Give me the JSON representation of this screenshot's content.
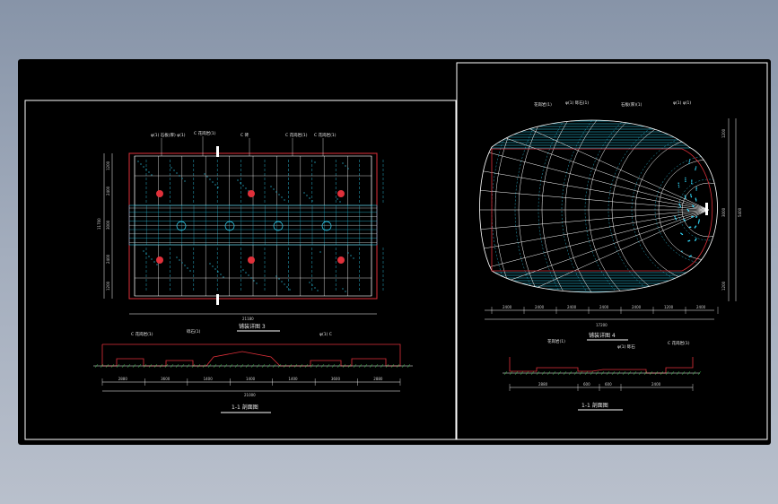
{
  "colors": {
    "background": "#000000",
    "frame": "#ffffff",
    "cyan": "#33ddff",
    "red": "#e0303a",
    "green": "#40ff60"
  },
  "left_sheet": {
    "plan_title": "铺装详图 3",
    "section_title": "1-1 剖面图",
    "callouts_top": [
      "φ(1) 石板(厚) φ(1)",
      "C 花岗岩(1)",
      "C 砖",
      "C 花岗岩(1)",
      "C 花岗岩(1)"
    ],
    "section_callouts": [
      "C 花岗岩(1)",
      "砾石(1)",
      "φ(1) C"
    ],
    "plan_total_width": "21180",
    "plan_left_dims": [
      "1200",
      "2400",
      "3000",
      "2400",
      "1200"
    ],
    "plan_total_height": "11700",
    "section_dims": [
      "2880",
      "3600",
      "1400",
      "1400",
      "1400",
      "3600",
      "2880"
    ],
    "section_total": "21000"
  },
  "right_sheet": {
    "plan_title": "铺装详图 4",
    "section_title": "1-1 剖面图",
    "callouts_top": [
      "花岗岩(1)",
      "φ(1) 砾石(1)",
      "石板(厚)(1)",
      "φ(1) φ(1)"
    ],
    "section_callouts": [
      "花岗岩(1)",
      "φ(1) 砾石",
      "C 花岗岩(1)"
    ],
    "bottom_dims": [
      "2400",
      "2400",
      "2400",
      "2400",
      "2400",
      "1200",
      "2400"
    ],
    "bottom_total": "17200",
    "right_dims": [
      "1200",
      "3000",
      "1200"
    ],
    "right_total": "5400",
    "section_dims": [
      "2880",
      "600",
      "600",
      "2400"
    ]
  }
}
